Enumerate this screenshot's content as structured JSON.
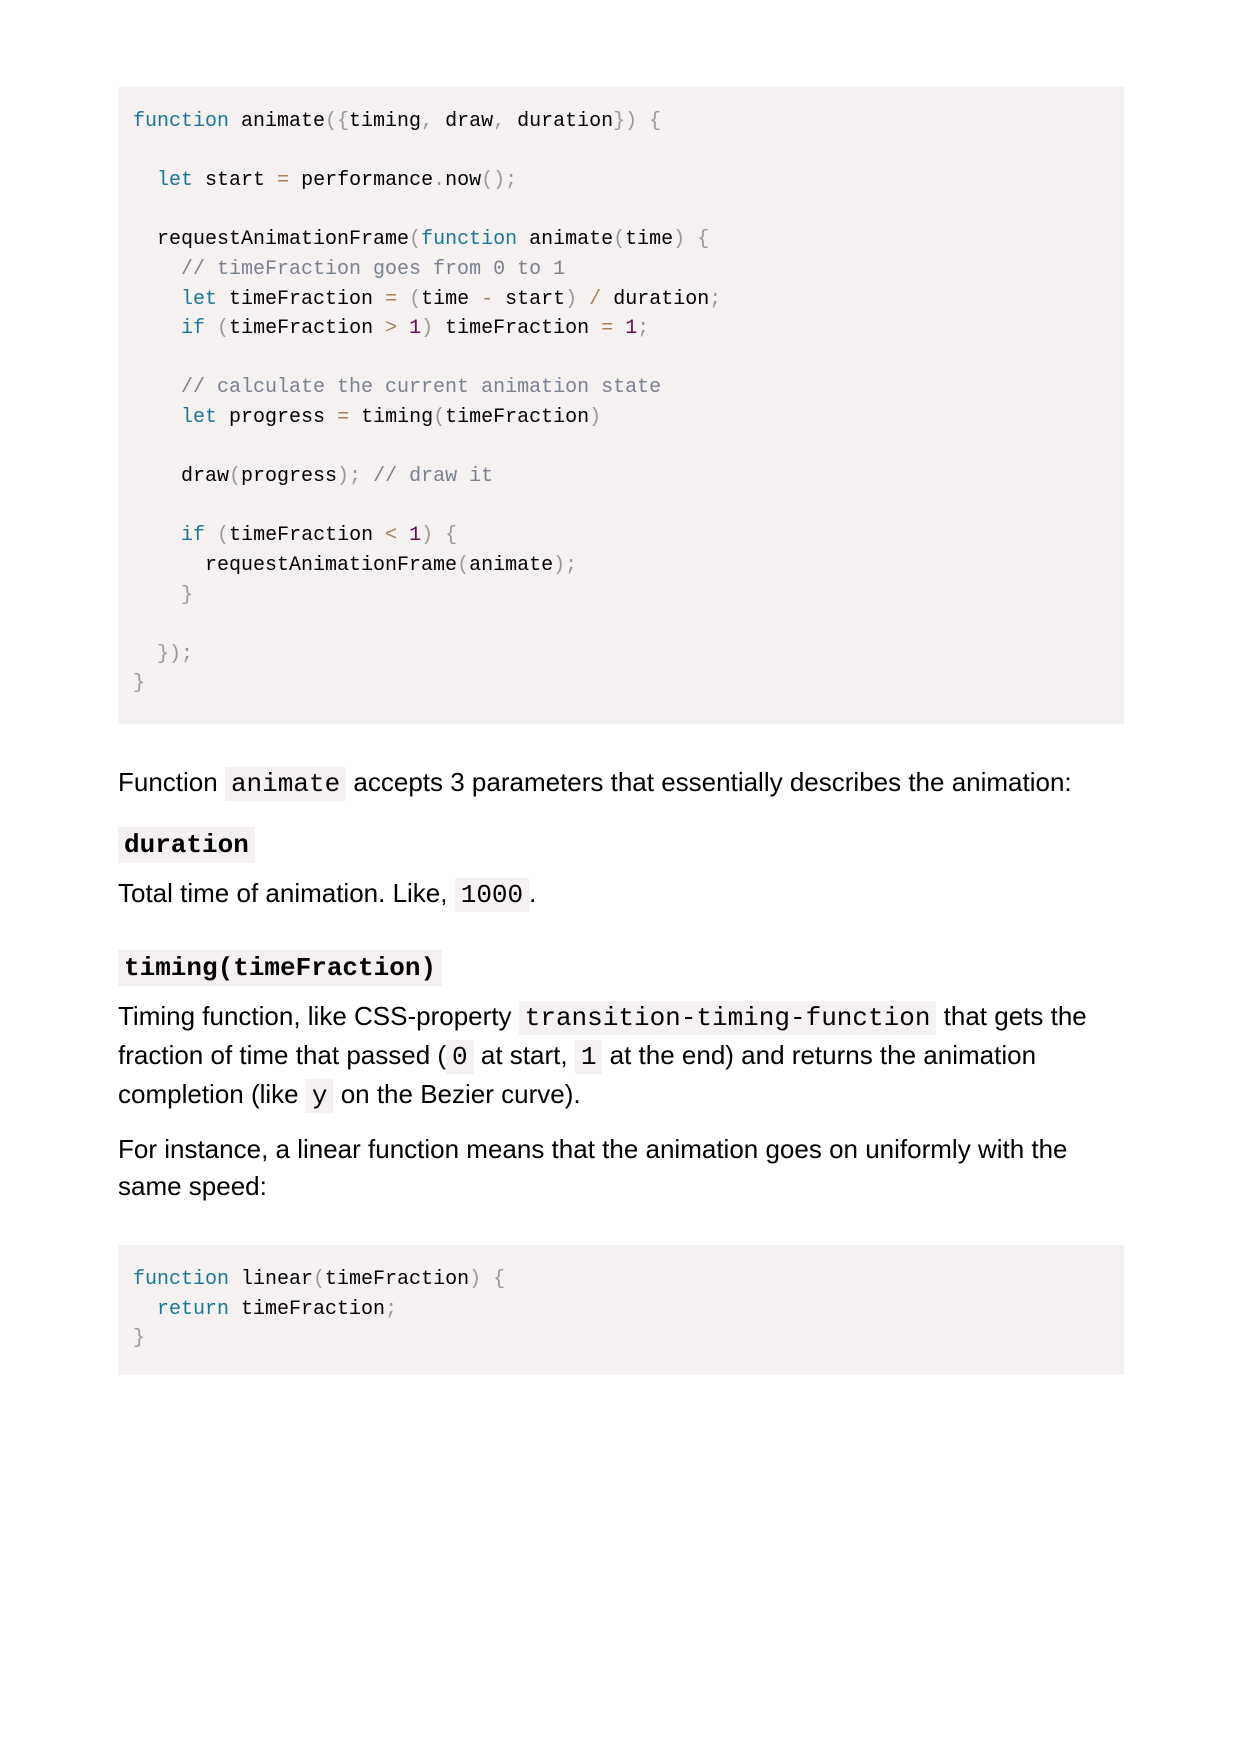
{
  "code_block_1": [
    [
      [
        "kw",
        "function"
      ],
      [
        "tx",
        " animate"
      ],
      [
        "pu",
        "({"
      ],
      [
        "tx",
        "timing"
      ],
      [
        "pu",
        ","
      ],
      [
        "tx",
        " draw"
      ],
      [
        "pu",
        ","
      ],
      [
        "tx",
        " duration"
      ],
      [
        "pu",
        "})"
      ],
      [
        "tx",
        " "
      ],
      [
        "pu",
        "{"
      ]
    ],
    [],
    [
      [
        "tx",
        "  "
      ],
      [
        "kw",
        "let"
      ],
      [
        "tx",
        " start "
      ],
      [
        "op",
        "="
      ],
      [
        "tx",
        " performance"
      ],
      [
        "pu",
        "."
      ],
      [
        "tx",
        "now"
      ],
      [
        "pu",
        "();"
      ]
    ],
    [],
    [
      [
        "tx",
        "  requestAnimationFrame"
      ],
      [
        "pu",
        "("
      ],
      [
        "kw",
        "function"
      ],
      [
        "tx",
        " animate"
      ],
      [
        "pu",
        "("
      ],
      [
        "tx",
        "time"
      ],
      [
        "pu",
        ")"
      ],
      [
        "tx",
        " "
      ],
      [
        "pu",
        "{"
      ]
    ],
    [
      [
        "tx",
        "    "
      ],
      [
        "cm",
        "// timeFraction goes from 0 to 1"
      ]
    ],
    [
      [
        "tx",
        "    "
      ],
      [
        "kw",
        "let"
      ],
      [
        "tx",
        " timeFraction "
      ],
      [
        "op",
        "="
      ],
      [
        "tx",
        " "
      ],
      [
        "pu",
        "("
      ],
      [
        "tx",
        "time "
      ],
      [
        "op",
        "-"
      ],
      [
        "tx",
        " start"
      ],
      [
        "pu",
        ")"
      ],
      [
        "tx",
        " "
      ],
      [
        "op",
        "/"
      ],
      [
        "tx",
        " duration"
      ],
      [
        "pu",
        ";"
      ]
    ],
    [
      [
        "tx",
        "    "
      ],
      [
        "kw",
        "if"
      ],
      [
        "tx",
        " "
      ],
      [
        "pu",
        "("
      ],
      [
        "tx",
        "timeFraction "
      ],
      [
        "op",
        ">"
      ],
      [
        "tx",
        " "
      ],
      [
        "nu",
        "1"
      ],
      [
        "pu",
        ")"
      ],
      [
        "tx",
        " timeFraction "
      ],
      [
        "op",
        "="
      ],
      [
        "tx",
        " "
      ],
      [
        "nu",
        "1"
      ],
      [
        "pu",
        ";"
      ]
    ],
    [],
    [
      [
        "tx",
        "    "
      ],
      [
        "cm",
        "// calculate the current animation state"
      ]
    ],
    [
      [
        "tx",
        "    "
      ],
      [
        "kw",
        "let"
      ],
      [
        "tx",
        " progress "
      ],
      [
        "op",
        "="
      ],
      [
        "tx",
        " timing"
      ],
      [
        "pu",
        "("
      ],
      [
        "tx",
        "timeFraction"
      ],
      [
        "pu",
        ")"
      ]
    ],
    [],
    [
      [
        "tx",
        "    draw"
      ],
      [
        "pu",
        "("
      ],
      [
        "tx",
        "progress"
      ],
      [
        "pu",
        ");"
      ],
      [
        "tx",
        " "
      ],
      [
        "cm",
        "// draw it"
      ]
    ],
    [],
    [
      [
        "tx",
        "    "
      ],
      [
        "kw",
        "if"
      ],
      [
        "tx",
        " "
      ],
      [
        "pu",
        "("
      ],
      [
        "tx",
        "timeFraction "
      ],
      [
        "op",
        "<"
      ],
      [
        "tx",
        " "
      ],
      [
        "nu",
        "1"
      ],
      [
        "pu",
        ")"
      ],
      [
        "tx",
        " "
      ],
      [
        "pu",
        "{"
      ]
    ],
    [
      [
        "tx",
        "      requestAnimationFrame"
      ],
      [
        "pu",
        "("
      ],
      [
        "tx",
        "animate"
      ],
      [
        "pu",
        ");"
      ]
    ],
    [
      [
        "tx",
        "    "
      ],
      [
        "pu",
        "}"
      ]
    ],
    [],
    [
      [
        "tx",
        "  "
      ],
      [
        "pu",
        "});"
      ]
    ],
    [
      [
        "pu",
        "}"
      ]
    ]
  ],
  "intro": {
    "before": "Function ",
    "code": "animate",
    "after": " accepts 3 parameters that essentially describes the animation:"
  },
  "term_duration": {
    "term": "duration",
    "desc_before": "Total time of animation. Like, ",
    "desc_code": "1000",
    "desc_after": "."
  },
  "term_timing": {
    "term": "timing(timeFraction)",
    "desc_1": "Timing function, like CSS-property ",
    "desc_code_1": "transition-timing-function",
    "desc_2": " that gets the fraction of time that passed (",
    "desc_code_2": "0",
    "desc_3": " at start, ",
    "desc_code_3": "1",
    "desc_4": " at the end) and returns the animation completion (like ",
    "desc_code_4": "y",
    "desc_5": " on the Bezier curve)."
  },
  "instance_paragraph": "For instance, a linear function means that the animation goes on uniformly with the same speed:",
  "code_block_2": [
    [
      [
        "kw",
        "function"
      ],
      [
        "tx",
        " linear"
      ],
      [
        "pu",
        "("
      ],
      [
        "tx",
        "timeFraction"
      ],
      [
        "pu",
        ")"
      ],
      [
        "tx",
        " "
      ],
      [
        "pu",
        "{"
      ]
    ],
    [
      [
        "tx",
        "  "
      ],
      [
        "kw",
        "return"
      ],
      [
        "tx",
        " timeFraction"
      ],
      [
        "pu",
        ";"
      ]
    ],
    [
      [
        "pu",
        "}"
      ]
    ]
  ]
}
